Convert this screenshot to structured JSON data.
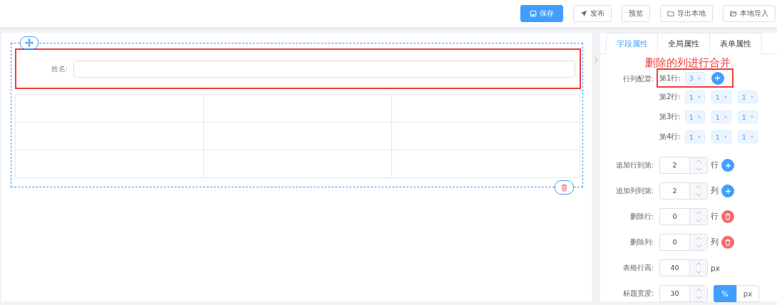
{
  "toolbar": {
    "buttons": [
      {
        "label": "保存",
        "kind": "primary"
      },
      {
        "label": "发布",
        "kind": "default"
      },
      {
        "label": "预览",
        "kind": "default"
      },
      {
        "label": "导出本地",
        "kind": "default"
      },
      {
        "label": "本地导入",
        "kind": "default"
      }
    ]
  },
  "canvas": {
    "field": {
      "label": "姓名:",
      "highlighted": true
    }
  },
  "panel": {
    "tabs": [
      {
        "label": "字段属性",
        "selected": true
      },
      {
        "label": "全局属性",
        "selected": false
      },
      {
        "label": "表单属性",
        "selected": false
      }
    ],
    "annotation": "删除的列进行合并",
    "row_config": {
      "label": "行列配置:",
      "rows": [
        {
          "label": "第1行:",
          "tags": [
            "3"
          ],
          "add": true,
          "highlighted": true
        },
        {
          "label": "第2行:",
          "tags": [
            "1",
            "1",
            "1"
          ],
          "add": false,
          "highlighted": false
        },
        {
          "label": "第3行:",
          "tags": [
            "1",
            "1",
            "1"
          ],
          "add": false,
          "highlighted": false
        },
        {
          "label": "第4行:",
          "tags": [
            "1",
            "1",
            "1"
          ],
          "add": false,
          "highlighted": false
        }
      ]
    },
    "fields": [
      {
        "label": "追加行到第:",
        "value": "2",
        "unit": "行",
        "kind": "add"
      },
      {
        "label": "追加列到第:",
        "value": "2",
        "unit": "列",
        "kind": "add"
      },
      {
        "label": "删除行:",
        "value": "0",
        "unit": "行",
        "kind": "delete"
      },
      {
        "label": "删除列:",
        "value": "0",
        "unit": "列",
        "kind": "delete"
      },
      {
        "label": "表格行高:",
        "value": "40",
        "unit": "px",
        "kind": "plain"
      },
      {
        "label": "标题宽度:",
        "value": "30",
        "kind": "toggle",
        "unit_options": [
          {
            "label": "%",
            "selected": true
          },
          {
            "label": "px",
            "selected": false
          }
        ]
      }
    ]
  }
}
